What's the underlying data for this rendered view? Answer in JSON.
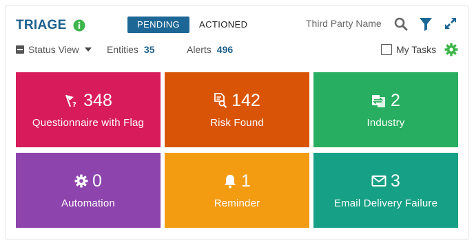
{
  "header": {
    "title": "TRIAGE",
    "tabs": [
      {
        "label": "PENDING",
        "active": true
      },
      {
        "label": "ACTIONED",
        "active": false
      }
    ],
    "search_placeholder": "Third Party Name",
    "icons": [
      "info-icon",
      "search-icon",
      "filter-icon",
      "expand-icon"
    ]
  },
  "toolbar": {
    "status_view_label": "Status View",
    "entities_label": "Entities",
    "entities_count": "35",
    "alerts_label": "Alerts",
    "alerts_count": "496",
    "my_tasks_label": "My Tasks",
    "my_tasks_checked": false
  },
  "tiles": [
    {
      "count": "348",
      "label": "Questionnaire with Flag",
      "color": "#d81b5a",
      "icon": "flag-question-icon"
    },
    {
      "count": "142",
      "label": "Risk Found",
      "color": "#d95406",
      "icon": "risk-document-icon"
    },
    {
      "count": "2",
      "label": "Industry",
      "color": "#27ae60",
      "icon": "industry-swap-icon"
    },
    {
      "count": "0",
      "label": "Automation",
      "color": "#8e44ad",
      "icon": "gear-icon"
    },
    {
      "count": "1",
      "label": "Reminder",
      "color": "#f39c12",
      "icon": "bell-icon"
    },
    {
      "count": "3",
      "label": "Email Delivery Failure",
      "color": "#16a085",
      "icon": "envelope-icon"
    }
  ],
  "colors": {
    "brand": "#1d5f8c",
    "accent_green": "#3db54a",
    "active_tab": "#1d6796"
  }
}
